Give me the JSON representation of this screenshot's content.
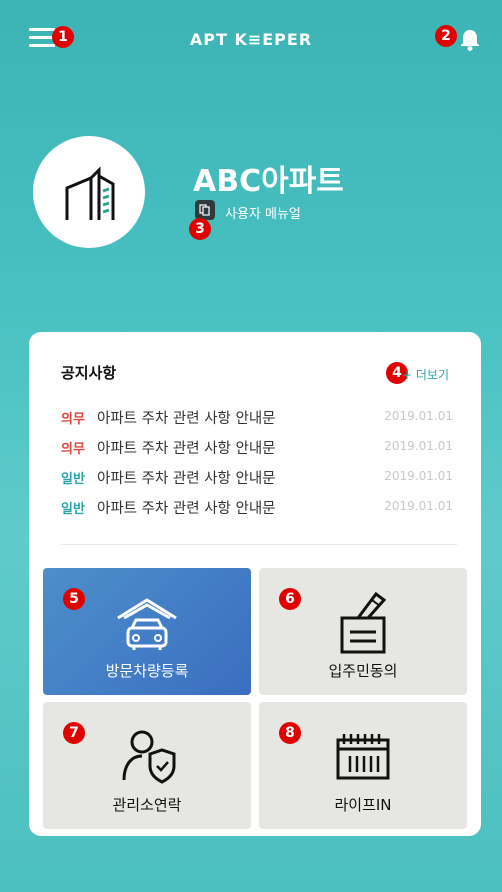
{
  "header": {
    "brand": "APT K≡EPER"
  },
  "badges": {
    "menu": "1",
    "bell": "2",
    "manual": "3",
    "more": "4",
    "tile1": "5",
    "tile2": "6",
    "tile3": "7",
    "tile4": "8"
  },
  "apartment": {
    "name": "ABC아파트",
    "manual_label": "사용자 메뉴얼"
  },
  "notices": {
    "title": "공지사항",
    "more_label": "+ 더보기",
    "items": [
      {
        "tag": "의무",
        "tag_color": "#e0463c",
        "text": "아파트 주차 관련 사항 안내문",
        "date": "2019.01.01"
      },
      {
        "tag": "의무",
        "tag_color": "#e0463c",
        "text": "아파트 주차 관련 사항 안내문",
        "date": "2019.01.01"
      },
      {
        "tag": "일반",
        "tag_color": "#2aa6a6",
        "text": "아파트 주차 관련 사항 안내문",
        "date": "2019.01.01"
      },
      {
        "tag": "일반",
        "tag_color": "#2aa6a6",
        "text": "아파트 주차 관련 사항 안내문",
        "date": "2019.01.01"
      }
    ]
  },
  "tiles": [
    {
      "label": "방문차량등록",
      "icon": "car-garage-icon",
      "active": true
    },
    {
      "label": "입주민동의",
      "icon": "vote-box-icon",
      "active": false
    },
    {
      "label": "관리소연락",
      "icon": "security-person-icon",
      "active": false
    },
    {
      "label": "라이프IN",
      "icon": "calendar-icon",
      "active": false
    }
  ],
  "colors": {
    "accent": "#3cb3b5",
    "active_tile": "#4c8fcb",
    "badge": "#e00000",
    "mandatory": "#e0463c",
    "general": "#2aa6a6"
  }
}
